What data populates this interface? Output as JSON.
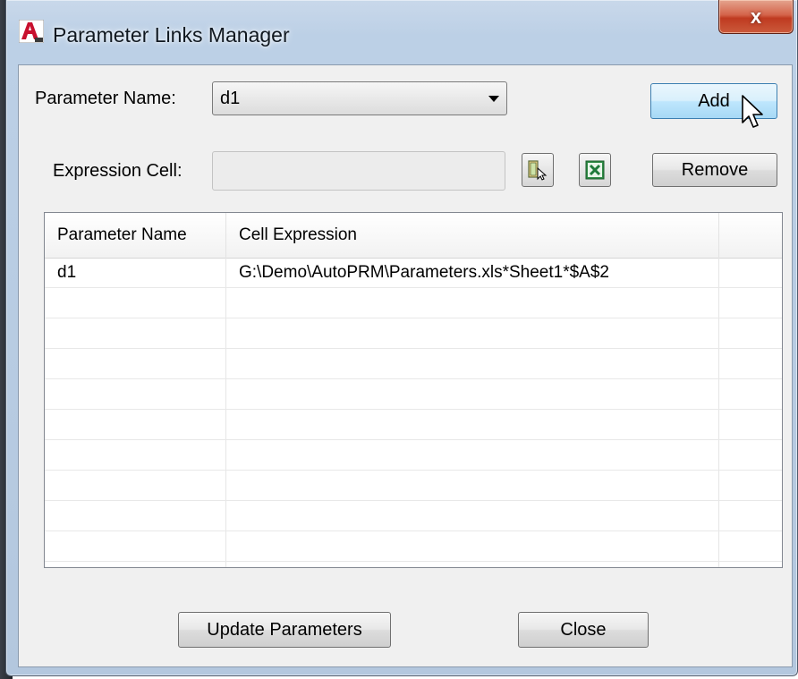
{
  "window": {
    "title": "Parameter Links Manager",
    "close_glyph": "x",
    "app_icon": "autocad-icon"
  },
  "form": {
    "parameter_name_label": "Parameter Name:",
    "parameter_name_value": "d1",
    "expression_cell_label": "Expression Cell:",
    "expression_cell_value": ""
  },
  "buttons": {
    "add": "Add",
    "remove": "Remove",
    "pick_cell_icon": "select-cell-icon",
    "excel_icon": "excel-icon",
    "update": "Update Parameters",
    "close": "Close"
  },
  "table": {
    "columns": [
      "Parameter Name",
      "Cell Expression",
      ""
    ],
    "rows": [
      [
        "d1",
        "G:\\Demo\\AutoPRM\\Parameters.xls*Sheet1*$A$2",
        ""
      ]
    ]
  },
  "colors": {
    "accent": "#3c7fb1",
    "close_red": "#c7412a",
    "excel_green": "#1e7a3a"
  }
}
